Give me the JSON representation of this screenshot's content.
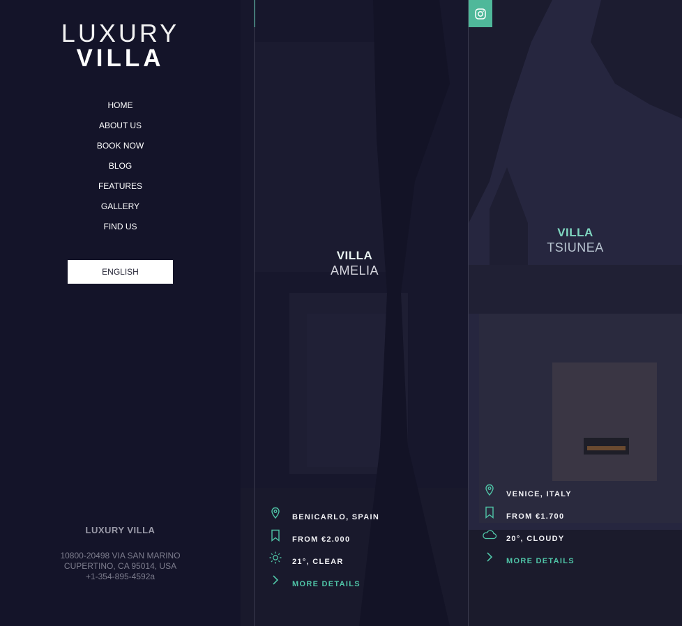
{
  "brand": {
    "line1": "LUXURY",
    "line2": "VILLA"
  },
  "nav": {
    "items": [
      {
        "label": "HOME"
      },
      {
        "label": "ABOUT US"
      },
      {
        "label": "BOOK NOW"
      },
      {
        "label": "BLOG"
      },
      {
        "label": "FEATURES"
      },
      {
        "label": "GALLERY"
      },
      {
        "label": "FIND US"
      }
    ]
  },
  "language": {
    "label": "ENGLISH"
  },
  "footer": {
    "title": "LUXURY VILLA",
    "address1": "10800-20498 VIA SAN MARINO",
    "address2": "CUPERTINO, CA 95014, USA",
    "phone": "+1-354-895-4592a"
  },
  "villas": [
    {
      "title1": "VILLA",
      "title2": "AMELIA",
      "location": "BENICARLO, SPAIN",
      "price": "FROM €2.000",
      "weather": "21°, CLEAR",
      "weather_icon": "sun-icon",
      "more": "MORE DETAILS"
    },
    {
      "title1": "VILLA",
      "title2": "TSIUNEA",
      "location": "VENICE, ITALY",
      "price": "FROM €1.700",
      "weather": "20°, CLOUDY",
      "weather_icon": "cloud-icon",
      "more": "MORE DETAILS"
    }
  ],
  "social": {
    "icon": "instagram-icon"
  },
  "colors": {
    "accent": "#4fc3a6",
    "background": "#141429"
  }
}
